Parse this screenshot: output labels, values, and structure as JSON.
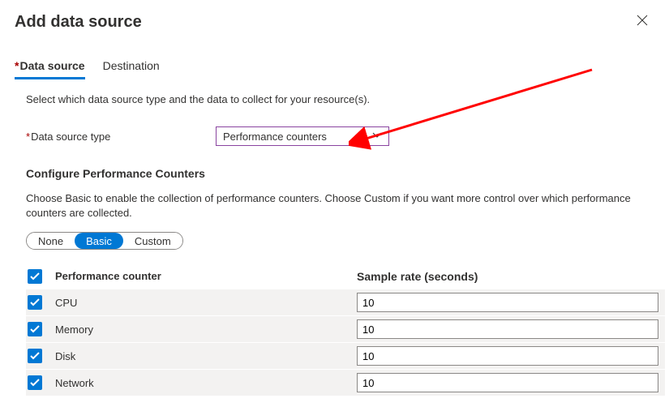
{
  "header": {
    "title": "Add data source"
  },
  "tabs": {
    "data_source": "Data source",
    "destination": "Destination"
  },
  "intro": "Select which data source type and the data to collect for your resource(s).",
  "field": {
    "label": "Data source type",
    "value": "Performance counters"
  },
  "section": {
    "title": "Configure Performance Counters",
    "desc": "Choose Basic to enable the collection of performance counters. Choose Custom if you want more control over which performance counters are collected."
  },
  "toggle": {
    "none": "None",
    "basic": "Basic",
    "custom": "Custom"
  },
  "table": {
    "header_counter": "Performance counter",
    "header_rate": "Sample rate (seconds)",
    "rows": [
      {
        "name": "CPU",
        "rate": "10"
      },
      {
        "name": "Memory",
        "rate": "10"
      },
      {
        "name": "Disk",
        "rate": "10"
      },
      {
        "name": "Network",
        "rate": "10"
      }
    ]
  }
}
